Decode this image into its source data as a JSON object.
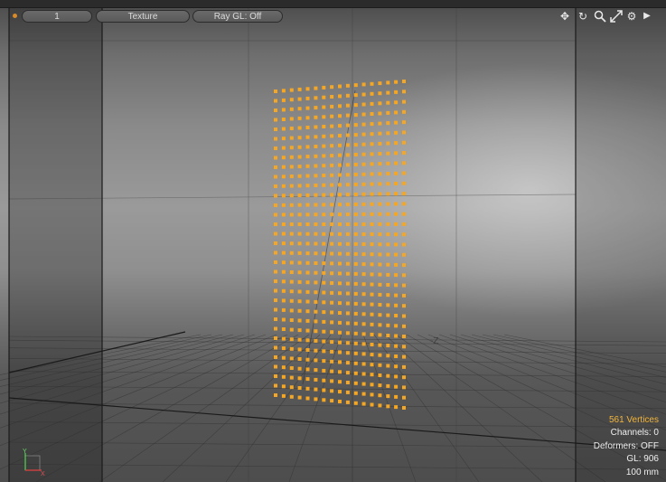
{
  "header": {
    "layout_value": "1",
    "shading_mode": "Texture",
    "raygl_label": "Ray GL: Off"
  },
  "toolbar": {
    "icons": [
      "move-icon",
      "rotate-icon",
      "zoom-icon",
      "maximize-icon",
      "gear-icon",
      "chevron-right-icon"
    ]
  },
  "scene": {
    "axis_label": "-Z",
    "axis_y": "Y",
    "axis_x": "X",
    "accent_color": "#f5a623"
  },
  "hud": {
    "vertices": "561 Vertices",
    "channels": "Channels: 0",
    "deformers": "Deformers: OFF",
    "gl": "GL: 906",
    "scale": "100 mm"
  }
}
